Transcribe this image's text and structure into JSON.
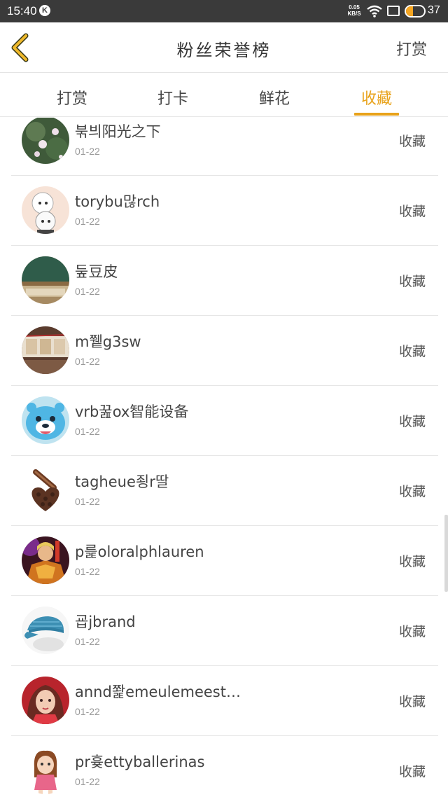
{
  "status_bar": {
    "time": "15:40",
    "k_badge": "K",
    "net_speed_value": "0.05",
    "net_speed_unit": "KB/S",
    "battery_level": 0.37,
    "battery_percent": "37"
  },
  "header": {
    "title": "粉丝荣誉榜",
    "right_action": "打赏"
  },
  "tabs": [
    {
      "label": "打赏",
      "active": false
    },
    {
      "label": "打卡",
      "active": false
    },
    {
      "label": "鲜花",
      "active": false
    },
    {
      "label": "收藏",
      "active": true
    }
  ],
  "list": [
    {
      "name": "붂븨阳光之下",
      "date": "01-22",
      "action": "收藏",
      "avatar": "lotus-flowers-avatar"
    },
    {
      "name": "torybu많rch",
      "date": "01-22",
      "action": "收藏",
      "avatar": "anime-characters-avatar"
    },
    {
      "name": "둪豆皮",
      "date": "01-22",
      "action": "收藏",
      "avatar": "chalkboard-classroom-avatar"
    },
    {
      "name": "m쮙g3sw",
      "date": "01-22",
      "action": "收藏",
      "avatar": "photo-strip-avatar"
    },
    {
      "name": "vrb꿆ox智能设备",
      "date": "01-22",
      "action": "收藏",
      "avatar": "blue-cartoon-avatar"
    },
    {
      "name": "tagheue죙r딸",
      "date": "01-22",
      "action": "收藏",
      "avatar": "coffee-beans-avatar"
    },
    {
      "name": "p릁oloralphlauren",
      "date": "01-22",
      "action": "收藏",
      "avatar": "armored-warrior-avatar"
    },
    {
      "name": "굡jbrand",
      "date": "01-22",
      "action": "收藏",
      "avatar": "blue-cap-avatar"
    },
    {
      "name": "annd쫥emeulemeest…",
      "date": "01-22",
      "action": "收藏",
      "avatar": "girl-portrait-avatar"
    },
    {
      "name": "pr흊ettyballerinas",
      "date": "01-22",
      "action": "收藏",
      "avatar": "cartoon-girl-avatar"
    }
  ],
  "colors": {
    "accent": "#e8a21a",
    "status_bar_bg": "#3a3a3a",
    "divider": "#e6e6e6",
    "text_primary": "#444444",
    "text_secondary": "#999999"
  }
}
